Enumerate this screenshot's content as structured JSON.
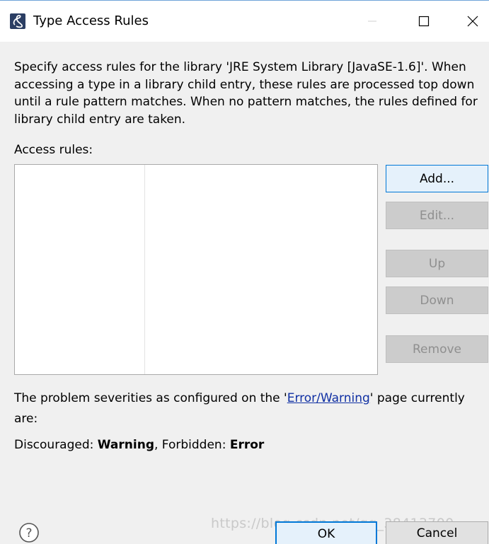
{
  "window": {
    "title": "Type Access Rules",
    "app_icon": "eclipse-type-icon",
    "controls": [
      "minimize-icon",
      "maximize-icon",
      "close-icon"
    ]
  },
  "description": "Specify access rules for the library 'JRE System Library [JavaSE-1.6]'. When accessing a type in a library child entry, these rules are processed top down until a rule pattern matches. When no pattern matches, the rules defined for library child entry are taken.",
  "access_rules": {
    "label": "Access rules:",
    "rows": []
  },
  "buttons": {
    "add": "Add...",
    "edit": "Edit...",
    "up": "Up",
    "down": "Down",
    "remove": "Remove"
  },
  "severity": {
    "prefix": "The problem severities as configured on the '",
    "link": "Error/Warning",
    "suffix": "' page currently are:",
    "discouraged_label": "Discouraged: ",
    "discouraged_value": "Warning",
    "separator": ", ",
    "forbidden_label": "Forbidden: ",
    "forbidden_value": "Error"
  },
  "footer": {
    "help_icon": "help-icon",
    "ok": "OK",
    "cancel": "Cancel",
    "watermark": "https://blog.csdn.net/qq_38413700"
  },
  "colors": {
    "link": "#0f2fa3",
    "focus_border": "#0078d7",
    "disabled_text": "#8f8f8f"
  }
}
